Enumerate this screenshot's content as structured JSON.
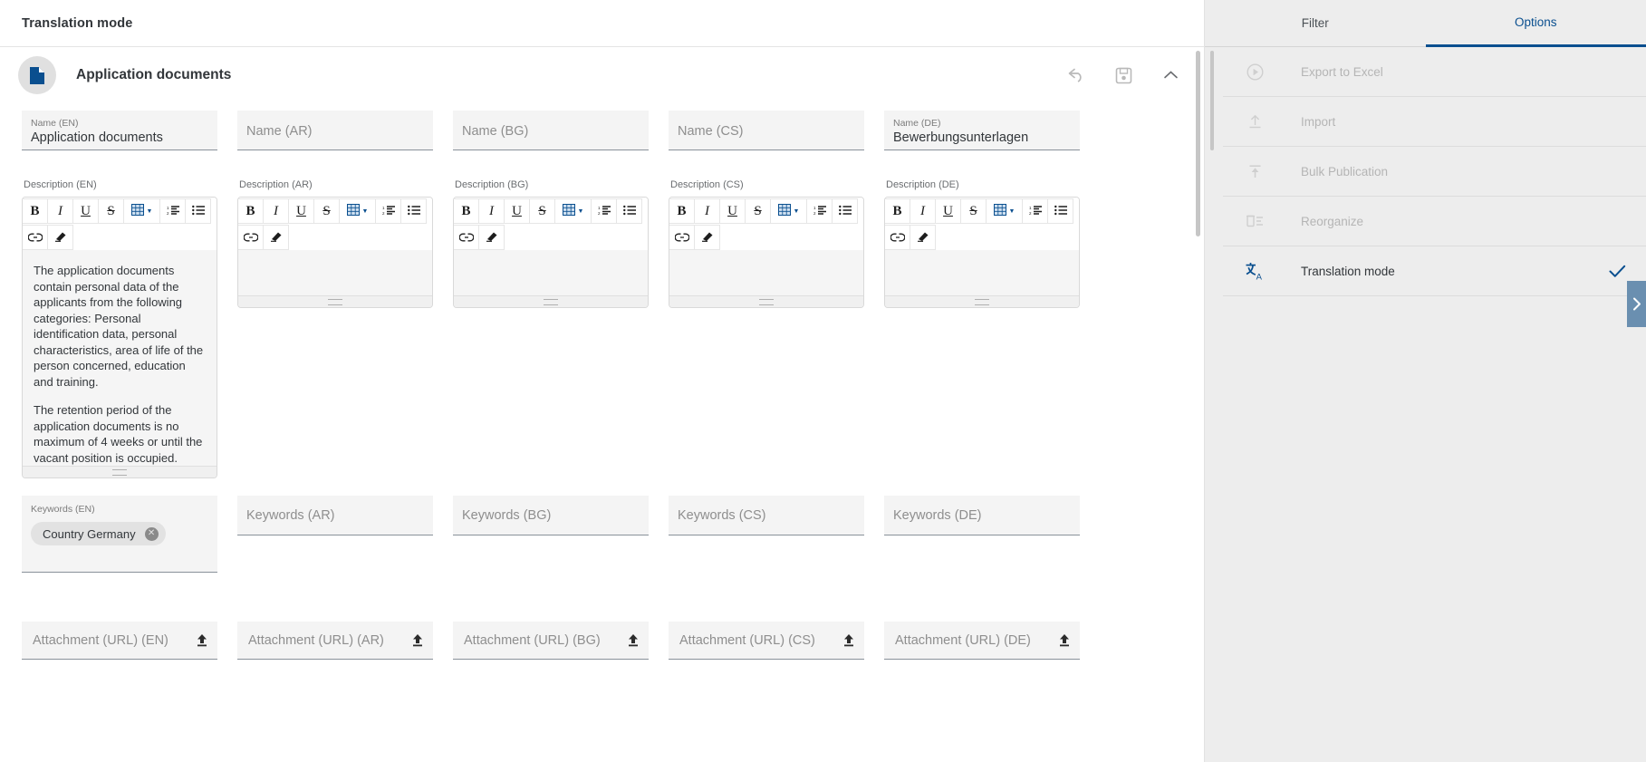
{
  "topbar": {
    "title": "Translation mode"
  },
  "card": {
    "title": "Application documents",
    "icon": "document-icon",
    "actions": {
      "undo": "undo-icon",
      "save": "save-icon",
      "collapse": "chevron-up-icon"
    }
  },
  "languages": [
    "EN",
    "AR",
    "BG",
    "CS",
    "DE"
  ],
  "name_row": [
    {
      "label": "Name (EN)",
      "value": "Application documents",
      "placeholder": "Name (EN)"
    },
    {
      "label": "Name (AR)",
      "value": "",
      "placeholder": "Name (AR)"
    },
    {
      "label": "Name (BG)",
      "value": "",
      "placeholder": "Name (BG)"
    },
    {
      "label": "Name (CS)",
      "value": "",
      "placeholder": "Name (CS)"
    },
    {
      "label": "Name (DE)",
      "value": "Bewerbungsunterlagen",
      "placeholder": "Name (DE)"
    }
  ],
  "description_row": [
    {
      "label": "Description (EN)",
      "paragraphs": [
        "The application documents contain personal data of the applicants from the following categories: Personal identification data, personal characteristics, area of life of the person concerned, education and training.",
        "The retention period of the application documents is no maximum of 4 weeks or until the vacant position is occupied."
      ]
    },
    {
      "label": "Description (AR)",
      "paragraphs": []
    },
    {
      "label": "Description (BG)",
      "paragraphs": []
    },
    {
      "label": "Description (CS)",
      "paragraphs": []
    },
    {
      "label": "Description (DE)",
      "paragraphs": []
    }
  ],
  "rte_toolbar": {
    "bold": "B",
    "italic": "I",
    "underline": "U",
    "strikethrough": "S",
    "table": "table-icon",
    "table_caret": "▼",
    "ordered_list": "ordered-list-icon",
    "unordered_list": "unordered-list-icon",
    "link": "link-icon",
    "eraser": "clear-formatting-icon"
  },
  "keywords_row": [
    {
      "label": "Keywords (EN)",
      "placeholder": "Keywords (EN)",
      "chips": [
        "Country Germany"
      ]
    },
    {
      "label": "Keywords (AR)",
      "placeholder": "Keywords (AR)",
      "chips": []
    },
    {
      "label": "Keywords (BG)",
      "placeholder": "Keywords (BG)",
      "chips": []
    },
    {
      "label": "Keywords (CS)",
      "placeholder": "Keywords (CS)",
      "chips": []
    },
    {
      "label": "Keywords (DE)",
      "placeholder": "Keywords (DE)",
      "chips": []
    }
  ],
  "attachment_row": [
    {
      "placeholder": "Attachment (URL) (EN)",
      "upload_icon": "upload-icon"
    },
    {
      "placeholder": "Attachment (URL) (AR)",
      "upload_icon": "upload-icon"
    },
    {
      "placeholder": "Attachment (URL) (BG)",
      "upload_icon": "upload-icon"
    },
    {
      "placeholder": "Attachment (URL) (CS)",
      "upload_icon": "upload-icon"
    },
    {
      "placeholder": "Attachment (URL) (DE)",
      "upload_icon": "upload-icon"
    }
  ],
  "side_panel": {
    "tabs": [
      {
        "label": "Filter",
        "active": false
      },
      {
        "label": "Options",
        "active": true
      }
    ],
    "options": [
      {
        "label": "Export to Excel",
        "icon": "play-circle-icon",
        "disabled": true,
        "checked": false
      },
      {
        "label": "Import",
        "icon": "import-icon",
        "disabled": true,
        "checked": false
      },
      {
        "label": "Bulk Publication",
        "icon": "bulk-publication-icon",
        "disabled": true,
        "checked": false
      },
      {
        "label": "Reorganize",
        "icon": "reorganize-icon",
        "disabled": true,
        "checked": false
      },
      {
        "label": "Translation mode",
        "icon": "translate-icon",
        "disabled": false,
        "checked": true
      }
    ],
    "collapse_handle": "chevron-right-icon"
  },
  "colors": {
    "accent": "#0a4f8f",
    "panel_bg": "#ededed",
    "field_bg": "#f4f4f4",
    "handle_bg": "#6a8fb0",
    "disabled_text": "#b5b5b5"
  }
}
